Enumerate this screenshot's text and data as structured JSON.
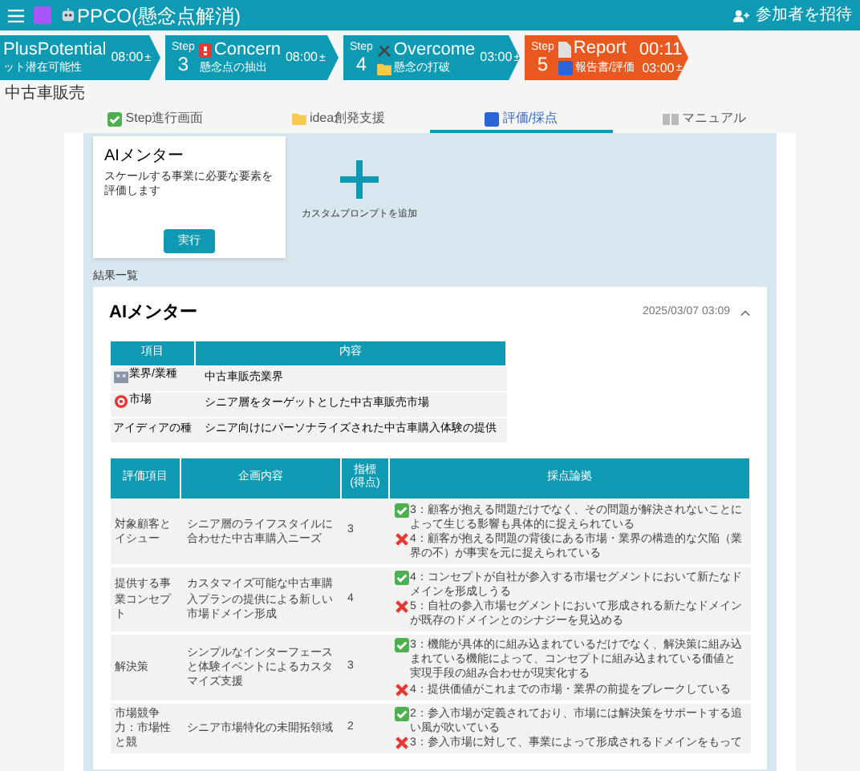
{
  "header": {
    "title": "PPCO(懸念点解消)",
    "invite": "参加者を招待"
  },
  "steps": [
    {
      "kind": "done",
      "name": "PlusPotential",
      "subtitle": "ット潜在可能性",
      "time": "08:00",
      "adjust": "±"
    },
    {
      "kind": "done",
      "step_label": "Step",
      "number": "3",
      "name": "Concern",
      "subtitle": "懸念点の抽出",
      "time": "08:00",
      "adjust": "±"
    },
    {
      "kind": "done",
      "step_label": "Step",
      "number": "4",
      "name": "Overcome",
      "subtitle": "懸念の打破",
      "time": "03:00",
      "adjust": "±"
    },
    {
      "kind": "active",
      "step_label": "Step",
      "number": "5",
      "name": "Report",
      "subtitle": "報告書/評価",
      "time": "03:00",
      "adjust": "±",
      "timer": "00:11"
    }
  ],
  "page_title": "中古車販売",
  "tabs": [
    {
      "label": "Step進行画面",
      "selected": false
    },
    {
      "label": "idea創発支援",
      "selected": false
    },
    {
      "label": "評価/採点",
      "selected": true
    },
    {
      "label": "マニュアル",
      "selected": false
    }
  ],
  "mentor_card": {
    "title": "AIメンター",
    "description": "スケールする事業に必要な要素を評価します",
    "button": "実行"
  },
  "add_prompt": {
    "label": "カスタムプロンプトを追加"
  },
  "results_label": "結果一覧",
  "result": {
    "title": "AIメンター",
    "timestamp": "2025/03/07 03:09",
    "expanded": true,
    "summary_table": {
      "columns": [
        "項目",
        "内容"
      ],
      "rows": [
        {
          "item": "業界/業種",
          "content": "中古車販売業界"
        },
        {
          "item": "市場",
          "content": "シニア層をターゲットとした中古車販売市場"
        },
        {
          "item": "アイディアの種",
          "content": "シニア向けにパーソナライズされた中古車購入体験の提供"
        }
      ]
    },
    "score_table": {
      "columns": [
        "評価項目",
        "企画内容",
        "指標\n(得点)",
        "採点論拠"
      ],
      "rows": [
        {
          "item": "対象顧客とイシュー",
          "plan": "シニア層のライフスタイルに合わせた中古車購入ニーズ",
          "score": "3",
          "reasons": [
            {
              "kind": "pass",
              "text": "3：顧客が抱える問題だけでなく、その問題が解決されないことによって生じる影響も具体的に捉えられている"
            },
            {
              "kind": "fail",
              "text": "4：顧客が抱える問題の背後にある市場・業界の構造的な欠陥（業界の不）が事実を元に捉えられている"
            }
          ]
        },
        {
          "item": "提供する事業コンセプト",
          "plan": "カスタマイズ可能な中古車購入プランの提供による新しい市場ドメイン形成",
          "score": "4",
          "reasons": [
            {
              "kind": "pass",
              "text": "4：コンセプトが自社が参入する市場セグメントにおいて新たなドメインを形成しうる"
            },
            {
              "kind": "fail",
              "text": "5：自社の参入市場セグメントにおいて形成される新たなドメインが既存のドメインとのシナジーを見込める"
            }
          ]
        },
        {
          "item": "解決策",
          "plan": "シンプルなインターフェースと体験イベントによるカスタマイズ支援",
          "score": "3",
          "reasons": [
            {
              "kind": "pass",
              "text": "3：機能が具体的に組み込まれているだけでなく、解決策に組み込まれている機能によって、コンセプトに組み込まれている価値と実現手段の組み合わせが現実化する"
            },
            {
              "kind": "fail",
              "text": "4：提供価値がこれまでの市場・業界の前提をブレークしている"
            }
          ]
        },
        {
          "item": "市場競争力：市場性と競",
          "plan": "シニア市場特化の未開拓領域",
          "score": "2",
          "reasons": [
            {
              "kind": "pass",
              "text": "2：参入市場が定義されており、市場には解決策をサポートする追い風が吹いている"
            },
            {
              "kind": "fail",
              "text": "3：参入市場に対して、事業によって形成されるドメインをもって"
            }
          ]
        }
      ]
    }
  }
}
